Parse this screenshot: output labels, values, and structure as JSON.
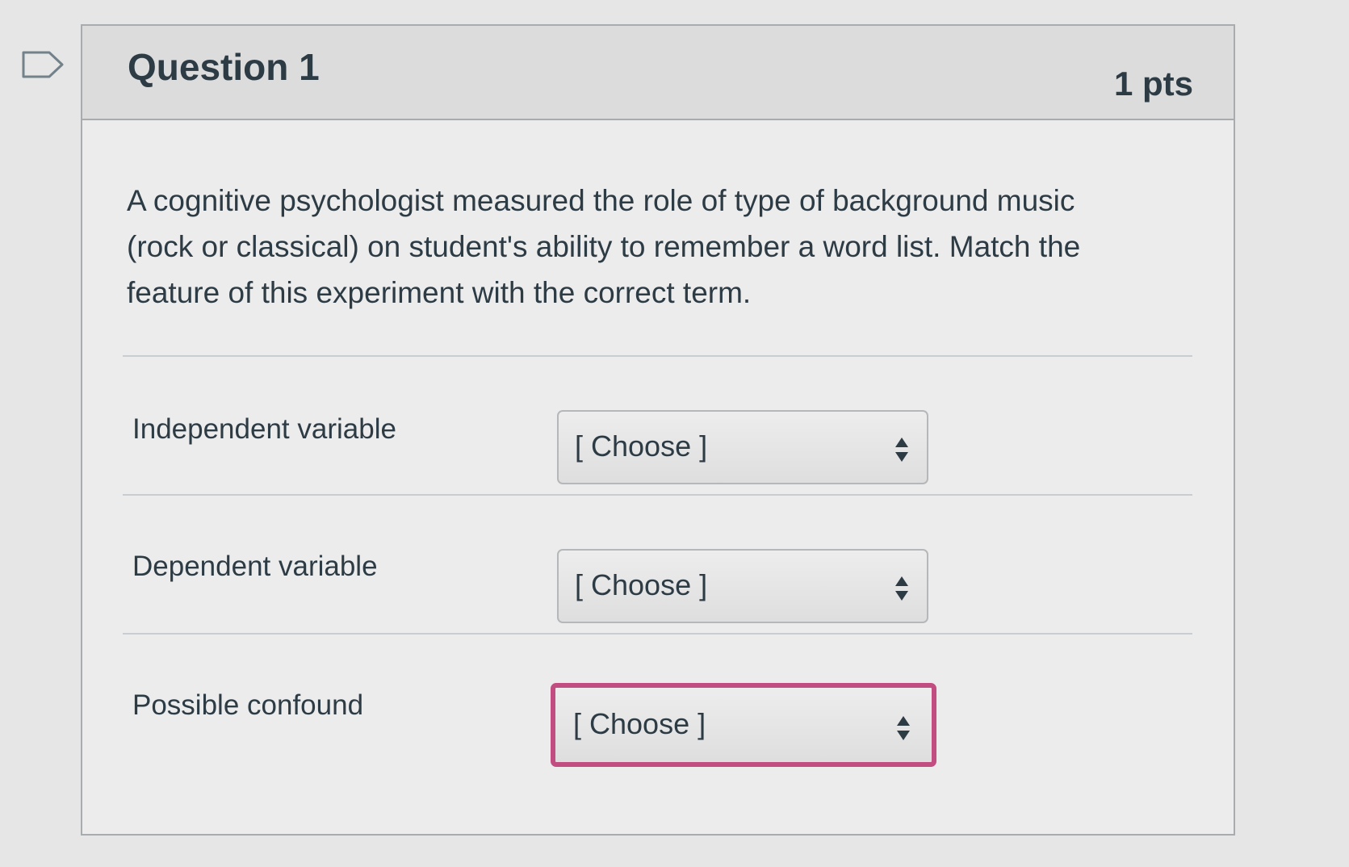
{
  "question": {
    "title": "Question 1",
    "points": "1 pts",
    "text": "A cognitive psychologist measured the role of type of background music (rock or classical) on student's ability to remember a word list. Match the feature of this experiment with the correct term."
  },
  "matches": [
    {
      "label": "Independent variable",
      "selected": "[ Choose ]"
    },
    {
      "label": "Dependent variable",
      "selected": "[ Choose ]"
    },
    {
      "label": "Possible confound",
      "selected": "[ Choose ]"
    }
  ],
  "icons": {
    "flag": "flag-question-icon",
    "select_arrows": "up-down-arrows-icon"
  },
  "colors": {
    "focus_border": "#c24d80",
    "text": "#2d3b45"
  }
}
